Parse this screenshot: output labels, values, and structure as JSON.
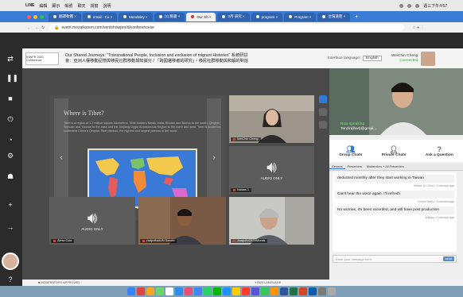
{
  "menubar": {
    "app": "LINE",
    "items": [
      "編輯",
      "顯示",
      "帳號",
      "聊天",
      "視窗",
      "說明"
    ],
    "clock": "週三下午4:57"
  },
  "browser": {
    "tabs": [
      "翻譯軟體 ×",
      "email - Co ×",
      "Mendeley ×",
      "(1) 臉書 ×",
      "Our Sh ×",
      "3月 研究 ×",
      "program ×",
      "Program ×",
      "台灣遠距 ×"
    ],
    "url": "event.mozaiksoon.com/ventshowpro/d/conferencese"
  },
  "header": {
    "logo_text": "IHWFR 2021 Conference",
    "title_line1": "Our Shared Journeys: \"Transnational People, Inclusion and exclusion of migrant Histories\" 系統研討",
    "title_line2": "會：亞洲人權移動記憶與移民社群移動與知識分 / 「跨國遷移者的研究」・移民社群移動與和解的對話",
    "language_label": "Interface language:",
    "language_value": "English",
    "user_name": "WeiChin Cheng",
    "user_status": "Connected"
  },
  "slide": {
    "title": "Where is Tibet?",
    "text": "Tibet is a region of 1.2 million square kilometers. Tibet borders Nepal, India, Bhutan and Burma to the south; Qinghai, Sichuan and Yunnan to the east; and the Xinjiang Uygur Autonomous Region to the north and west. Tibet is located in southwest China's Qinghai-Tibet plateau, the highest and largest plateau in the world.",
    "map_caption": "The World"
  },
  "tiles": {
    "woman_name": "WeiChin Cheng",
    "audio_top_label": "AUDIO ONLY",
    "audio_top_name": "Nalaas 1",
    "audio_bottom_label": "AUDIO ONLY",
    "audio_bottom_name": "Alexa Cole",
    "man1_name": "zadpoftaAUN Sondhi",
    "man2_name": "Joaquín/CKTzMorais"
  },
  "speaker": {
    "now_speaking": "Now speaking",
    "speaker_name": "Tenzin(ihwt)@grnai..."
  },
  "tools": {
    "group": "Group Chats",
    "private": "Private Chats",
    "ask": "Ask a Question"
  },
  "chat": {
    "tabs": [
      "General",
      "Presenters",
      "Moderators + All Presenters"
    ],
    "messages": [
      {
        "text": "deducted monthly after they start working in Taiwan",
        "meta": "Hector (Li Chin) • 2 minutes ago"
      },
      {
        "text": "Can't hear the voice again. I'll refresh",
        "meta": "Lesoni Hetty • 3 minutes ago"
      },
      {
        "text": "No worries, it's been recorded, and will have post production",
        "meta": "Wijaya • 2 minutes ago"
      }
    ],
    "input_placeholder": "Enter your message here",
    "send_label": "send"
  },
  "footer": {
    "left": "■ MODERATORS APPROVED",
    "right": "YOUR LANGUAGE"
  },
  "colors": {
    "tab_blue": "#3a7bd5",
    "stage_grey": "#4a4a4a",
    "accent_blue": "#3377cc"
  }
}
